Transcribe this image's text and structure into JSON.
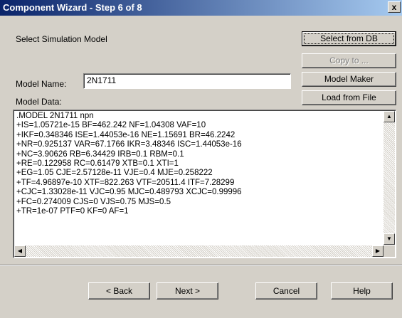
{
  "window": {
    "title": "Component Wizard - Step 6 of 8",
    "close_label": "x"
  },
  "section": {
    "heading": "Select Simulation Model"
  },
  "side_buttons": {
    "select_from_db": "Select from DB",
    "copy_to": "Copy to ...",
    "model_maker": "Model Maker",
    "load_from_file": "Load from File"
  },
  "model_name": {
    "label": "Model Name:",
    "value": "2N1711"
  },
  "model_data": {
    "label": "Model Data:",
    "lines": [
      ".MODEL 2N1711 npn",
      "+IS=1.05721e-15 BF=462.242 NF=1.04308 VAF=10",
      "+IKF=0.348346 ISE=1.44053e-16 NE=1.15691 BR=46.2242",
      "+NR=0.925137 VAR=67.1766 IKR=3.48346 ISC=1.44053e-16",
      "+NC=3.90626 RB=6.34429 IRB=0.1 RBM=0.1",
      "+RE=0.122958 RC=0.61479 XTB=0.1 XTI=1",
      "+EG=1.05 CJE=2.57128e-11 VJE=0.4 MJE=0.258222",
      "+TF=4.96897e-10 XTF=822.263 VTF=20511.4 ITF=7.28299",
      "+CJC=1.33028e-11 VJC=0.95 MJC=0.489793 XCJC=0.99996",
      "+FC=0.274009 CJS=0 VJS=0.75 MJS=0.5",
      "+TR=1e-07 PTF=0 KF=0 AF=1"
    ]
  },
  "footer_buttons": {
    "back": "< Back",
    "next": "Next >",
    "cancel": "Cancel",
    "help": "Help"
  },
  "icons": {
    "scroll_up": "arrow-up-icon",
    "scroll_down": "arrow-down-icon",
    "scroll_left": "arrow-left-icon",
    "scroll_right": "arrow-right-icon"
  },
  "colors": {
    "title_gradient_start": "#0a246a",
    "title_gradient_end": "#a6caf0",
    "dialog_bg": "#d4d0c8"
  }
}
